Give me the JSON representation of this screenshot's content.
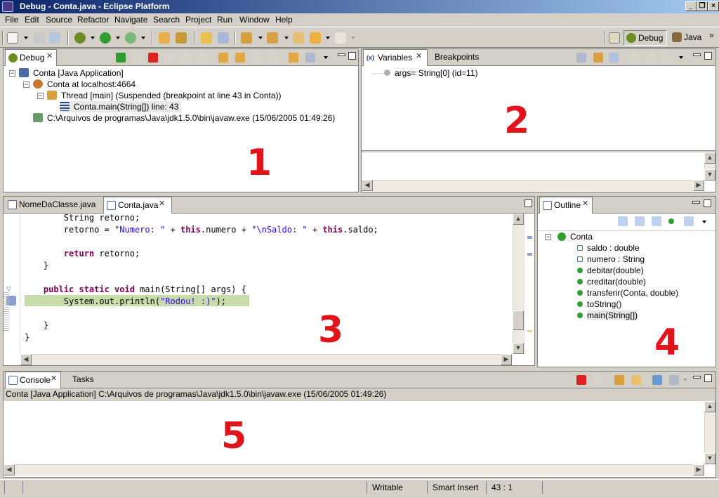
{
  "window": {
    "title": "Debug - Conta.java - Eclipse Platform"
  },
  "menu": [
    "File",
    "Edit",
    "Source",
    "Refactor",
    "Navigate",
    "Search",
    "Project",
    "Run",
    "Window",
    "Help"
  ],
  "perspectives": {
    "debug": "Debug",
    "java": "Java"
  },
  "debug_view": {
    "tab": "Debug",
    "tree": [
      "Conta [Java Application]",
      "Conta at localhost:4664",
      "Thread [main] (Suspended (breakpoint at line 43 in Conta))",
      "Conta.main(String[]) line: 43",
      "C:\\Arquivos de programas\\Java\\jdk1.5.0\\bin\\javaw.exe (15/06/2005 01:49:26)"
    ],
    "marker": "1"
  },
  "variables_view": {
    "tabs": [
      "Variables",
      "Breakpoints"
    ],
    "rows": [
      "args= String[0]  (id=11)"
    ],
    "marker": "2"
  },
  "editor": {
    "tabs": [
      "NomeDaClasse.java",
      "Conta.java"
    ],
    "marker": "3"
  },
  "outline_view": {
    "tab": "Outline",
    "root": "Conta",
    "members": [
      "saldo : double",
      "numero : String",
      "debitar(double)",
      "creditar(double)",
      "transferir(Conta, double)",
      "toString()",
      "main(String[])"
    ],
    "marker": "4"
  },
  "console_view": {
    "tabs": [
      "Console",
      "Tasks"
    ],
    "header": "Conta [Java Application] C:\\Arquivos de programas\\Java\\jdk1.5.0\\bin\\javaw.exe (15/06/2005 01:49:26)",
    "marker": "5"
  },
  "status_bar": {
    "mode": "Writable",
    "insert": "Smart Insert",
    "position": "43 : 1"
  },
  "colors": {
    "title_start": "#0a246a",
    "title_end": "#a6caf0",
    "current_line": "#c8dcaa",
    "marker": "#e0141a",
    "keyword": "#7f0055",
    "string": "#2a00ff"
  }
}
